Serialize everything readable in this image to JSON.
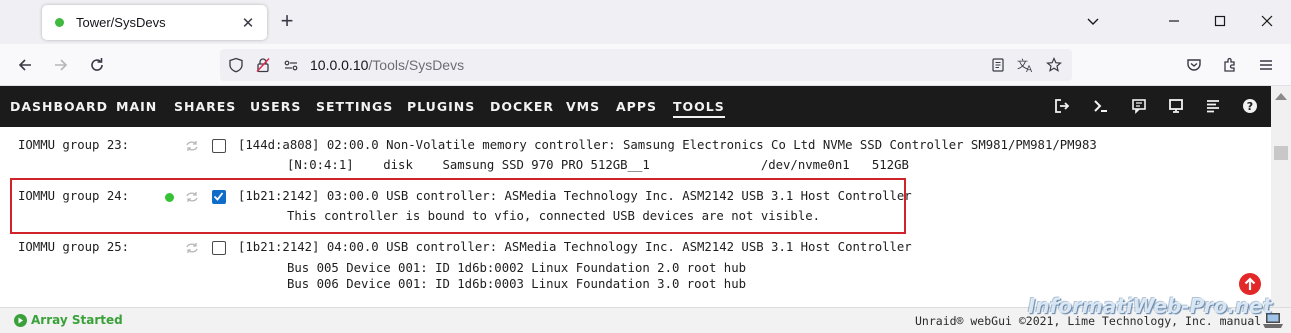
{
  "browser": {
    "tab_title": "Tower/SysDevs",
    "url_host": "10.0.0.10",
    "url_path": "/Tools/SysDevs"
  },
  "menu": {
    "items": [
      "DASHBOARD",
      "MAIN",
      "SHARES",
      "USERS",
      "SETTINGS",
      "PLUGINS",
      "DOCKER",
      "VMS",
      "APPS",
      "TOOLS"
    ],
    "active": "TOOLS"
  },
  "iommu_groups": [
    {
      "label": "IOMMU group 23:",
      "checked": false,
      "bound": false,
      "device": "[144d:a808] 02:00.0 Non-Volatile memory controller: Samsung Electronics Co Ltd NVMe SSD Controller SM981/PM981/PM983",
      "details": [
        "[N:0:4:1]    disk    Samsung SSD 970 PRO 512GB__1               /dev/nvme0n1   512GB"
      ]
    },
    {
      "label": "IOMMU group 24:",
      "checked": true,
      "bound": true,
      "device": "[1b21:2142] 03:00.0 USB controller: ASMedia Technology Inc. ASM2142 USB 3.1 Host Controller",
      "details": [
        "This controller is bound to vfio, connected USB devices are not visible."
      ]
    },
    {
      "label": "IOMMU group 25:",
      "checked": false,
      "bound": false,
      "device": "[1b21:2142] 04:00.0 USB controller: ASMedia Technology Inc. ASM2142 USB 3.1 Host Controller",
      "details": [
        "Bus 005 Device 001: ID 1d6b:0002 Linux Foundation 2.0 root hub",
        "Bus 006 Device 001: ID 1d6b:0003 Linux Foundation 3.0 root hub"
      ]
    }
  ],
  "footer": {
    "status": "Array Started",
    "copyright": "Unraid® webGui ©2021, Lime Technology, Inc.  manual"
  },
  "watermark": "InformatiWeb-Pro.net",
  "colors": {
    "menu_bg": "#1c1b1b",
    "status_green": "#3aa13a",
    "highlight_red": "#d0232a",
    "checkbox_blue": "#0f6cc9"
  }
}
